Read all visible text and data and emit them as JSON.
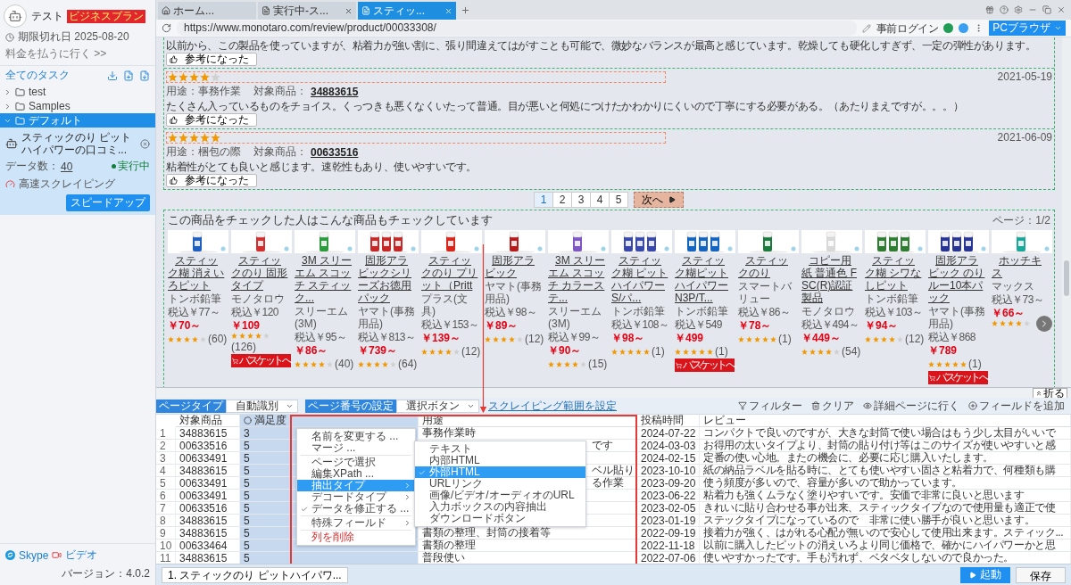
{
  "sidebar": {
    "user": {
      "name": "テスト",
      "plan": "ビジネスプラン",
      "expiry": "期限切れ日 2025-08-20",
      "pay_link": "料金を払うに行く >>"
    },
    "tasks_title": "全てのタスク",
    "tree": [
      {
        "kind": "folder",
        "label": "test",
        "expanded": false,
        "selected": false
      },
      {
        "kind": "folder",
        "label": "Samples",
        "expanded": false,
        "selected": false
      },
      {
        "kind": "folder",
        "label": "デフォルト",
        "expanded": true,
        "selected": true,
        "children": [
          {
            "kind": "task",
            "title": "スティックのり ピットハイパワーの口コミ...",
            "count_label": "データ数：",
            "count": "40",
            "status": "実行中",
            "mode": "高速スクレイピング",
            "action": "スピードアップ"
          }
        ]
      }
    ],
    "footer": {
      "skype": "Skype",
      "video": "ビデオ",
      "version": "バージョン：4.0.2"
    }
  },
  "browser": {
    "tabs": [
      {
        "kind": "home",
        "label": "ホーム...",
        "selected": false
      },
      {
        "kind": "page",
        "label": "実行中-ス...",
        "selected": false
      },
      {
        "kind": "page",
        "label": "スティッ...",
        "selected": true
      }
    ],
    "url": "https://www.monotaro.com/review/product/00033308/",
    "login": "事前ログイン",
    "mode_button": "PCブラウザ"
  },
  "reviews": [
    {
      "text": "以前から、この製品を使っていますが、粘着力が強い割に、張り間違えてはがすことも可能で、微妙なバランスが最高と感じています。乾燥しても硬化しすぎず、一定の弾性があります。",
      "helpful": "参考になった"
    },
    {
      "stars": 4,
      "date": "2021-05-19",
      "usage": "用途：事務作業",
      "product_label": "対象商品：",
      "product": "34883615",
      "text": "たくさん入っているものをチョイス。くっつきも悪くなくいたって普通。目が悪いと何処につけたかわかりにくいので丁寧にする必要がある。（あたりまえですが。。。）",
      "helpful": "参考になった"
    },
    {
      "stars": 5,
      "date": "2021-06-09",
      "usage": "用途：梱包の際",
      "product_label": "対象商品：",
      "product": "00633516",
      "text": "粘着性がとても良いと感じます。速乾性もあり、使いやすいです。",
      "helpful": "参考になった"
    }
  ],
  "pagination": {
    "pages": [
      {
        "label": "1",
        "selected": true
      },
      {
        "label": "2",
        "selected": false
      },
      {
        "label": "3",
        "selected": false
      },
      {
        "label": "4",
        "selected": false
      },
      {
        "label": "5",
        "selected": false
      }
    ],
    "next": "次へ"
  },
  "recommendations": {
    "title": "この商品をチェックした人はこんな商品もチェックしています",
    "page": "ページ：1/2",
    "products": [
      {
        "name": "スティック糊 消えいろピット",
        "maker": "トンボ鉛筆",
        "tax_price": "税込￥77～",
        "price": "￥70～",
        "stars": 4,
        "count": "(60)"
      },
      {
        "name": "スティックのり 固形タイプ",
        "maker": "モノタロウ",
        "tax_price": "税込￥120",
        "price": "￥109",
        "stars": 4,
        "count": "(126)",
        "basket": "バスケットへ"
      },
      {
        "name": "3M スリーエム スコッチ スティック...",
        "maker": "スリーエム(3M)",
        "tax_price": "税込￥95～",
        "price": "￥86～",
        "stars": 4,
        "count": "(40)"
      },
      {
        "name": "固形アラビックシリーズお徳用パック",
        "maker": "ヤマト(事務用品)",
        "tax_price": "税込￥813～",
        "price": "￥739～",
        "stars": 4,
        "count": "(64)"
      },
      {
        "name": "スティックのり プリット（Pritt",
        "maker": "プラス(文具)",
        "tax_price": "税込￥153～",
        "price": "￥139～",
        "stars": 4,
        "count": "(12)"
      },
      {
        "name": "固形アラビック",
        "maker": "ヤマト(事務用品)",
        "tax_price": "税込￥98～",
        "price": "￥89～",
        "stars": 4,
        "count": "(12)"
      },
      {
        "name": "3M スリーエム スコッチ カラーステ...",
        "maker": "スリーエム(3M)",
        "tax_price": "税込￥99～",
        "price": "￥90～",
        "stars": 4,
        "count": "(15)"
      },
      {
        "name": "スティック糊 ピットハイパワーS/パ...",
        "maker": "トンボ鉛筆",
        "tax_price": "税込￥108～",
        "price": "￥98～",
        "stars": 5,
        "count": "(1)"
      },
      {
        "name": "スティック糊ピットハイパワーN3P/T...",
        "maker": "トンボ鉛筆",
        "tax_price": "税込￥549",
        "price": "￥499",
        "stars": 5,
        "count": "(1)",
        "basket": "バスケットへ"
      },
      {
        "name": "スティックのり",
        "maker": "スマートバリュー",
        "tax_price": "税込￥86～",
        "price": "￥78～",
        "stars": 5,
        "count": "(1)"
      },
      {
        "name": "コピー用紙 普通色 FSC(R)認証製品",
        "maker": "モノタロウ",
        "tax_price": "税込￥494～",
        "price": "￥449～",
        "stars": 4,
        "count": "(54)"
      },
      {
        "name": "スティック糊 シワなしピット",
        "maker": "トンボ鉛筆",
        "tax_price": "税込￥103～",
        "price": "￥94～",
        "stars": 4,
        "count": "(12)"
      },
      {
        "name": "固形アラビック のりルー10本パック",
        "maker": "ヤマト(事務用品)",
        "tax_price": "税込￥868",
        "price": "￥789",
        "stars": 5,
        "count": "(1)",
        "basket": "バスケットへ"
      },
      {
        "name": "ホッチキス",
        "maker": "マックス",
        "tax_price": "税込￥73～",
        "price": "￥66～",
        "stars": 4
      }
    ]
  },
  "collapse": "折る",
  "data_panel": {
    "page_type_label": "ページタイプ",
    "page_type": "自動識別",
    "page_number_label": "ページ番号の設定",
    "page_number": "選択ボタン",
    "range_link": "スクレイピング範囲を設定",
    "tools": [
      {
        "kind": "filter",
        "label": "フィルター"
      },
      {
        "kind": "clear",
        "label": "クリア"
      },
      {
        "kind": "detail",
        "label": "詳細ページに行く"
      },
      {
        "kind": "add",
        "label": "フィールドを追加"
      }
    ]
  },
  "table": {
    "columns": [
      {
        "label": "対象商品",
        "selected": false
      },
      {
        "label": "満足度",
        "selected": true
      },
      {
        "label": "用途",
        "selected": false
      },
      {
        "label": "投稿時間",
        "selected": false
      },
      {
        "label": "レビュー",
        "selected": false
      }
    ],
    "rows": [
      {
        "index": "1",
        "product": "34883615",
        "rating": "3",
        "usage": "事務作業時",
        "posted": "2024-07-22",
        "review": "コンパクトで良いのですが、大きな封筒で使い場合はもう少し太目がいいで"
      },
      {
        "index": "2",
        "product": "00633516",
        "rating": "5",
        "usage": "です",
        "usage_clipped": true,
        "posted": "2024-03-03",
        "review": "お得用の太いタイプより、封筒の貼り付け等はこのサイズが使いやすいと感"
      },
      {
        "index": "3",
        "product": "00633491",
        "rating": "5",
        "posted": "2024-02-15",
        "review": "定番の使い心地。またの機会に、必要に応じ購入いたします。"
      },
      {
        "index": "4",
        "product": "34883615",
        "rating": "5",
        "usage": "ベル貼り",
        "usage_clipped": true,
        "posted": "2023-10-10",
        "review": "紙の納品ラベルを貼る時に、とても使いやすい固さと粘着力で、何種類も購"
      },
      {
        "index": "5",
        "product": "00633491",
        "rating": "5",
        "usage": "る作業",
        "usage_clipped": true,
        "posted": "2023-09-20",
        "review": "使う頻度が多いので、容量が多いので助かっています。"
      },
      {
        "index": "6",
        "product": "00633491",
        "rating": "5",
        "posted": "2023-06-22",
        "review": "粘着力も強くムラなく塗りやすいです。安価で非常に良いと思います"
      },
      {
        "index": "7",
        "product": "00633516",
        "rating": "5",
        "posted": "2023-02-05",
        "review": "きれいに貼り合わせる事が出来、スティックタイプなので使用量も適正で使"
      },
      {
        "index": "8",
        "product": "34883615",
        "rating": "5",
        "posted": "2023-01-19",
        "review": "ステックタイプになっているので　非常に使い勝手が良いと思います。"
      },
      {
        "index": "9",
        "product": "34883615",
        "rating": "5",
        "usage": "書類の整理、封筒の接着等",
        "posted": "2022-09-19",
        "review": "接着力が強く、はがれる心配が無いので安心して使用出来ます。スティック..."
      },
      {
        "index": "10",
        "product": "00633464",
        "rating": "5",
        "usage": "書類の整理",
        "posted": "2022-11-18",
        "review": "以前に購入したピットの消えいろより同じ価格で、確かにハイパワーかと思"
      },
      {
        "index": "11",
        "product": "34883615",
        "rating": "5",
        "usage": "普段使い",
        "posted": "2022-07-06",
        "review": "使いやすかったです。手も汚れず、ベタベタしないので良かった。"
      }
    ]
  },
  "context_menu": {
    "groups": [
      [
        {
          "label": "名前を変更する ...",
          "kind": "action",
          "selected": false,
          "checked": false
        },
        {
          "label": "マージ ...",
          "kind": "action",
          "selected": false,
          "checked": false
        }
      ],
      [
        {
          "label": "ページで選択",
          "kind": "action",
          "selected": false,
          "checked": false
        },
        {
          "label": "編集XPath ...",
          "kind": "action",
          "selected": false,
          "checked": false
        },
        {
          "label": "抽出タイプ",
          "kind": "submenu",
          "selected": true,
          "checked": false
        },
        {
          "label": "デコードタイプ",
          "kind": "submenu",
          "selected": false,
          "checked": false
        },
        {
          "label": "データを修正する ...",
          "kind": "action",
          "selected": false,
          "checked": true
        }
      ],
      [
        {
          "label": "特殊フィールド",
          "kind": "submenu",
          "selected": false,
          "checked": false
        }
      ],
      [
        {
          "label": "列を削除",
          "kind": "danger",
          "selected": false,
          "checked": false
        }
      ]
    ],
    "submenu": [
      {
        "label": "テキスト",
        "selected": false
      },
      {
        "label": "内部HTML",
        "selected": false
      },
      {
        "label": "外部HTML",
        "selected": true
      },
      {
        "label": "URLリンク",
        "selected": false
      },
      {
        "label": "画像/ビデオ/オーディオのURL",
        "selected": false
      },
      {
        "label": "入力ボックスの内容抽出",
        "selected": false
      },
      {
        "label": "ダウンロードボタン",
        "selected": false
      }
    ]
  },
  "bottom": {
    "task_tabs": [
      "1. スティックのり ピットハイパワ..."
    ],
    "start": "起動",
    "save": "保存"
  }
}
